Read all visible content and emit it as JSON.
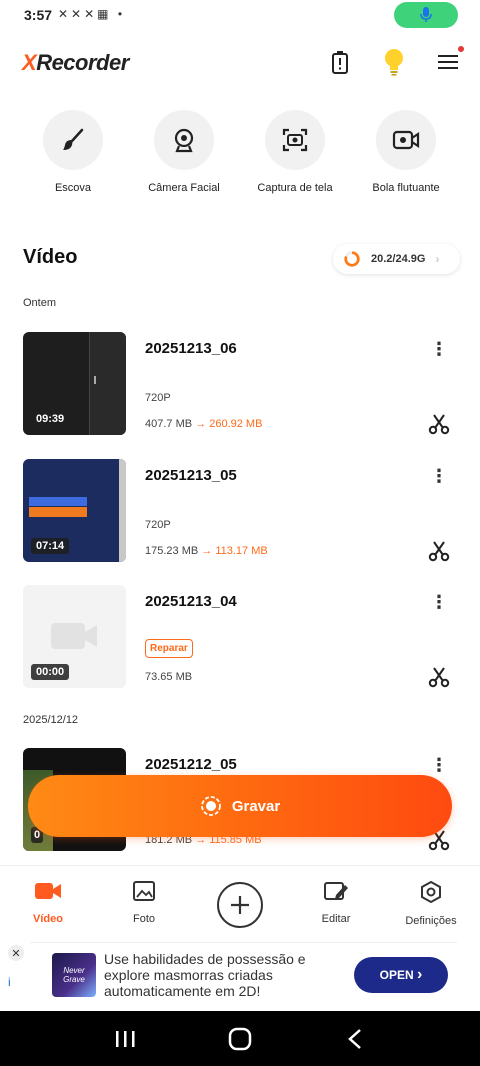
{
  "status_bar": {
    "time": "3:57",
    "notification_icons": "✕✕✕▦ •"
  },
  "header": {
    "logo_x": "X",
    "logo_rest": "Recorder"
  },
  "tools": [
    {
      "label": "Escova",
      "icon": "brush-icon"
    },
    {
      "label": "Câmera Facial",
      "icon": "webcam-icon"
    },
    {
      "label": "Captura de tela",
      "icon": "screenshot-icon"
    },
    {
      "label": "Bola flutuante",
      "icon": "floating-ball-icon"
    }
  ],
  "video_section": {
    "title": "Vídeo",
    "storage": "20.2/24.9G",
    "storage_used_fraction": 0.81
  },
  "groups": [
    {
      "date": "Ontem"
    },
    {
      "date": "2025/12/12"
    }
  ],
  "videos": [
    {
      "name": "20251213_06",
      "duration": "09:39",
      "resolution": "720P",
      "size": "407.7 MB",
      "arrow": "→",
      "compressed": "260.92 MB"
    },
    {
      "name": "20251213_05",
      "duration": "07:14",
      "resolution": "720P",
      "size": "175.23 MB",
      "arrow": "→",
      "compressed": "113.17 MB"
    },
    {
      "name": "20251213_04",
      "duration": "00:00",
      "repair": "Reparar",
      "size": "73.65 MB"
    },
    {
      "name": "20251212_05",
      "duration": "0",
      "size": "181.2 MB",
      "arrow": "→",
      "compressed": "115.85 MB"
    }
  ],
  "record_button": {
    "label": "Gravar"
  },
  "bottom_nav": [
    {
      "label": "Vídeo",
      "active": true
    },
    {
      "label": "Foto"
    },
    {
      "label": "Editar"
    },
    {
      "label": "Definições"
    }
  ],
  "ad": {
    "close": "✕",
    "info": "i",
    "game_name": "Never Grave",
    "text": "Use habilidades de possessão e explore masmorras criadas automaticamente em 2D!",
    "cta": "OPEN",
    "cta_chevron": "›"
  },
  "colors": {
    "accent": "#ff5a1f",
    "mic_pill": "#3ed27a",
    "ad_button": "#1e2a8a"
  }
}
